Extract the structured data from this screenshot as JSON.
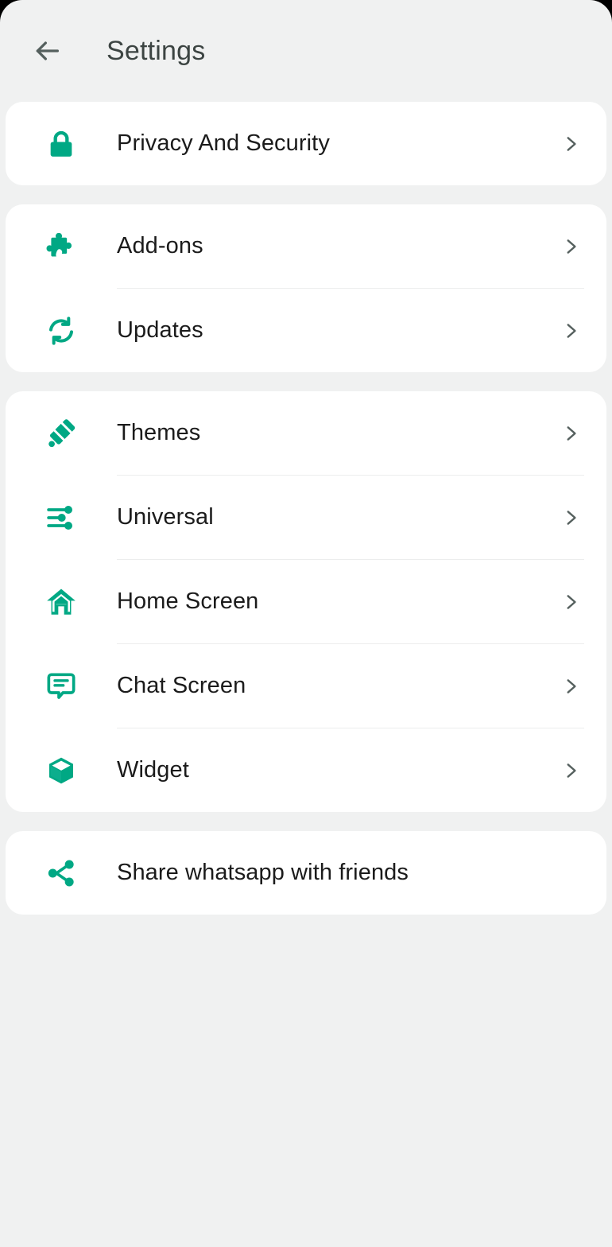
{
  "theme": {
    "accent": "#00A884",
    "background": "#F0F1F1",
    "card": "#FFFFFF",
    "title_color": "#3C4442",
    "label_color": "#1B1B1B",
    "chevron_color": "#55605E",
    "divider_color": "#ECEDED"
  },
  "header": {
    "back_icon": "arrow-left-icon",
    "title": "Settings"
  },
  "groups": [
    {
      "id": "privacy-group",
      "items": [
        {
          "id": "privacy-and-security",
          "label": "Privacy And Security",
          "icon": "lock-icon",
          "chevron": true
        }
      ]
    },
    {
      "id": "extensions-group",
      "items": [
        {
          "id": "add-ons",
          "label": "Add-ons",
          "icon": "puzzle-piece-icon",
          "chevron": true
        },
        {
          "id": "updates",
          "label": "Updates",
          "icon": "sync-refresh-icon",
          "chevron": true
        }
      ]
    },
    {
      "id": "appearance-group",
      "items": [
        {
          "id": "themes",
          "label": "Themes",
          "icon": "paint-roller-icon",
          "chevron": true
        },
        {
          "id": "universal",
          "label": "Universal",
          "icon": "sliders-tune-icon",
          "chevron": true
        },
        {
          "id": "home-screen",
          "label": "Home Screen",
          "icon": "home-icon",
          "chevron": true
        },
        {
          "id": "chat-screen",
          "label": "Chat Screen",
          "icon": "chat-bubble-icon",
          "chevron": true
        },
        {
          "id": "widget",
          "label": "Widget",
          "icon": "cube-box-icon",
          "chevron": true
        }
      ]
    },
    {
      "id": "share-group",
      "items": [
        {
          "id": "share-whatsapp-with-friends",
          "label": "Share whatsapp with friends",
          "icon": "share-nodes-icon",
          "chevron": false
        }
      ]
    }
  ]
}
